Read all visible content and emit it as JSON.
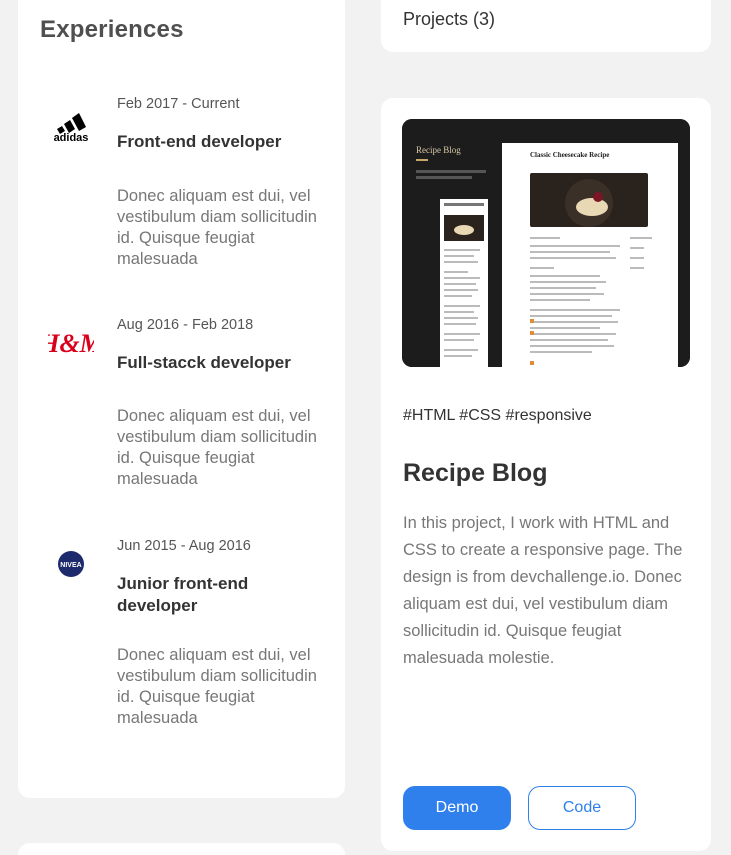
{
  "experiences": {
    "title": "Experiences",
    "items": [
      {
        "logo": "adidas",
        "date": "Feb 2017 - Current",
        "role": "Front-end developer",
        "desc": "Donec aliquam est dui, vel vestibulum diam sollicitudin id. Quisque feugiat malesuada"
      },
      {
        "logo": "H&M",
        "date": "Aug 2016 - Feb 2018",
        "role": "Full-stacck developer",
        "desc": "Donec aliquam est dui, vel vestibulum diam sollicitudin id. Quisque feugiat malesuada"
      },
      {
        "logo": "NIVEA",
        "date": "Jun 2015 - Aug 2016",
        "role": "Junior front-end developer",
        "desc": "Donec aliquam est dui, vel vestibulum diam sollicitudin id. Quisque feugiat malesuada"
      }
    ]
  },
  "projects": {
    "header_label": "Projects (3)",
    "card": {
      "thumb": {
        "blog_title": "Recipe Blog",
        "page_title": "Classic Cheesecake Recipe"
      },
      "tags": "#HTML #CSS #responsive",
      "title": "Recipe Blog",
      "desc": "In this project, I work with HTML and CSS to create a responsive page. The design is from devchallenge.io. Donec aliquam est dui, vel vestibulum diam sollicitudin id. Quisque feugiat malesuada molestie.",
      "demo_label": "Demo",
      "code_label": "Code"
    }
  },
  "colors": {
    "accent": "#2f80ed",
    "background": "#f2f2f2",
    "nivea_blue": "#1d2a6b",
    "hm_red": "#d9001b"
  }
}
